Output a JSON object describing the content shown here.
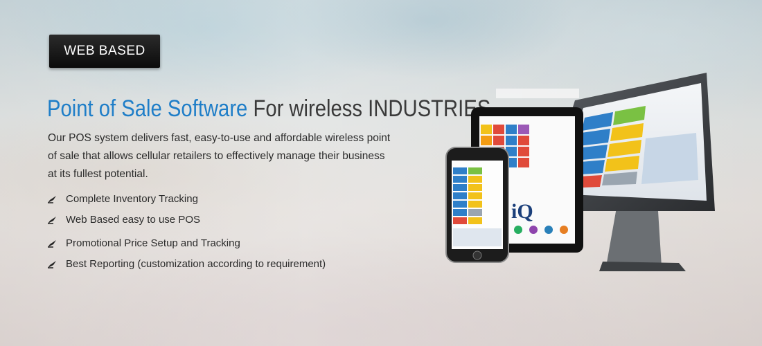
{
  "badge": {
    "label": "WEB BASED"
  },
  "headline": {
    "highlight": "Point of Sale Software",
    "rest": "For wireless INDUSTRIES"
  },
  "description": "Our POS system delivers fast, easy-to-use and affordable wireless point of sale that allows cellular retailers to effectively manage their business at its fullest potential.",
  "features": [
    {
      "label": "Complete Inventory Tracking",
      "icon": "feather-bullet-icon"
    },
    {
      "label": "Web Based easy to use POS",
      "icon": "feather-bullet-icon"
    },
    {
      "label": "Promotional Price Setup and Tracking",
      "icon": "feather-bullet-icon"
    },
    {
      "label": "Best Reporting (customization according to requirement)",
      "icon": "feather-bullet-icon"
    }
  ],
  "devices_image": {
    "logo_text": "iQ"
  },
  "colors": {
    "headline_blue": "#1f7ec8",
    "badge_bg": "#111111"
  }
}
